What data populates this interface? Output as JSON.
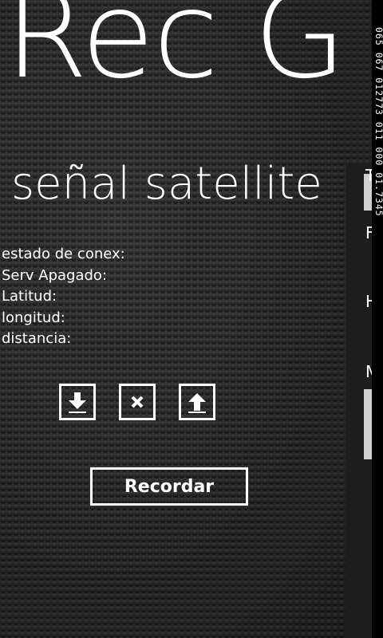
{
  "header": {
    "app_title": "Rec G",
    "page_title": "señal satellite"
  },
  "info": [
    {
      "label": "estado de conex:"
    },
    {
      "label": "Serv Apagado:"
    },
    {
      "label": "Latitud:"
    },
    {
      "label": "longitud:"
    },
    {
      "label": "distancia:"
    }
  ],
  "controls": {
    "icons": [
      "download-arrow-icon",
      "close-x-icon",
      "upload-arrow-icon"
    ],
    "record_label": "Recordar"
  },
  "side_panel": {
    "letters": [
      "T",
      "F",
      "H",
      "M"
    ]
  },
  "debug_counter": "065 067 012773 011 000 01.7345",
  "colors": {
    "foreground": "#ffffff",
    "background": "#2b2b2b"
  }
}
